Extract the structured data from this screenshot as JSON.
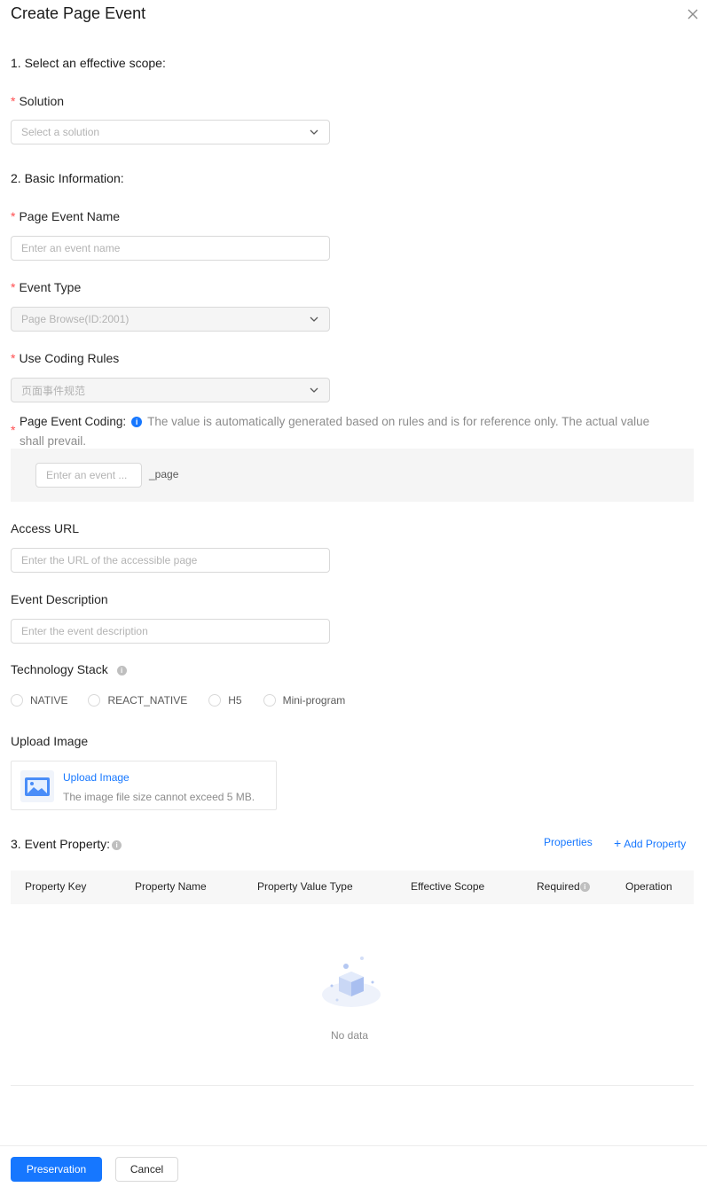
{
  "dialog": {
    "title": "Create Page Event"
  },
  "section1": {
    "title": "1. Select an effective scope:"
  },
  "solution": {
    "label": "Solution",
    "placeholder": "Select a solution"
  },
  "section2": {
    "title": "2. Basic Information:"
  },
  "event_name": {
    "label": "Page Event Name",
    "placeholder": "Enter an event name"
  },
  "event_type": {
    "label": "Event Type",
    "value": "Page Browse(ID:2001)"
  },
  "coding_rules": {
    "label": "Use Coding Rules",
    "value": "页面事件规范"
  },
  "event_coding": {
    "label": "Page Event Coding:",
    "hint": "The value is automatically generated based on rules and is for reference only. The actual value shall prevail.",
    "placeholder": "Enter an event ...",
    "suffix": "_page"
  },
  "access_url": {
    "label": "Access URL",
    "placeholder": "Enter the URL of the accessible page"
  },
  "description": {
    "label": "Event Description",
    "placeholder": "Enter the event description"
  },
  "tech_stack": {
    "label": "Technology Stack",
    "options": [
      "NATIVE",
      "REACT_NATIVE",
      "H5",
      "Mini-program"
    ]
  },
  "upload": {
    "label": "Upload Image",
    "link": "Upload Image",
    "hint": "The image file size cannot exceed 5 MB."
  },
  "section3": {
    "title": "3. Event Property:",
    "properties_link": "Properties",
    "add_link": "Add Property",
    "columns": [
      "Property Key",
      "Property Name",
      "Property Value Type",
      "Effective Scope",
      "Required",
      "Operation"
    ],
    "empty_text": "No data"
  },
  "footer": {
    "save_label": "Preservation",
    "cancel_label": "Cancel"
  },
  "colors": {
    "primary": "#1677ff",
    "required": "#ff4d4f"
  }
}
